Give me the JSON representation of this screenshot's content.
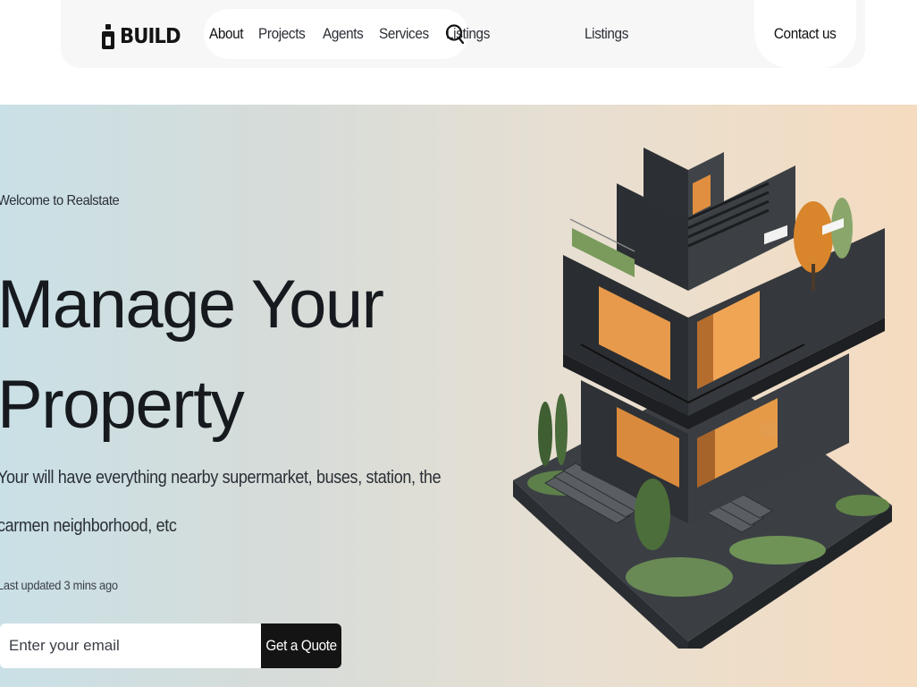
{
  "brand": {
    "name": "BUILD"
  },
  "nav": {
    "items": [
      {
        "label": "About"
      },
      {
        "label": "Projects"
      },
      {
        "label": "Agents"
      },
      {
        "label": "Services"
      },
      {
        "label": "Listings"
      }
    ],
    "listings_label": "Listings",
    "contact_label": "Contact us"
  },
  "hero": {
    "eyebrow": "Welcome to Realstate",
    "headline_line1": "Manage Your",
    "headline_line2": "Property",
    "description": "Your will have everything nearby supermarket, buses, station, the carmen neighborhood, etc",
    "updated": "Last updated 3 mins ago",
    "email_placeholder": "Enter your email",
    "cta_label": "Get a Quote"
  },
  "colors": {
    "accent": "#141414",
    "hero_gradient_start": "#c9e0e6",
    "hero_gradient_end": "#f5dcc0"
  },
  "icons": {
    "search": "search-icon",
    "logo": "logo-icon"
  }
}
